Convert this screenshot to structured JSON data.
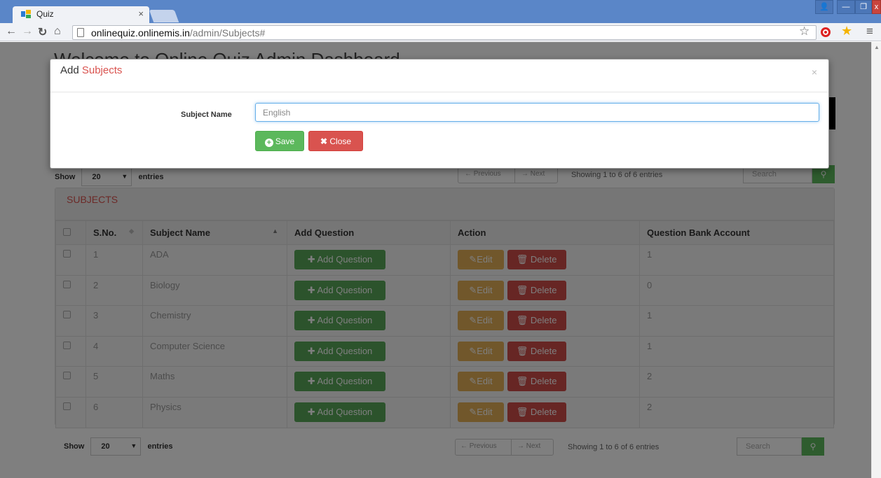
{
  "browser": {
    "tab_title": "Quiz",
    "tab_close": "×",
    "url_host": "onlinequiz.onlinemis.in",
    "url_path": "/admin/Subjects#",
    "window_user_icon": "👤",
    "window_min": "—",
    "window_max": "❐",
    "window_close": "x"
  },
  "page": {
    "heading": "Welcome to Online Quiz Admin Dashboard",
    "show_label": "Show",
    "entries_label": "entries",
    "page_length": "20",
    "prev_label": "← Previous",
    "next_label": "→ Next",
    "info_text": "Showing 1 to 6 of 6 entries",
    "search_placeholder": "Search",
    "panel_title": "SUBJECTS"
  },
  "table": {
    "columns": [
      "S.No.",
      "Subject Name",
      "Add Question",
      "Action",
      "Question Bank Account"
    ],
    "add_question_label": "Add Question",
    "edit_label": "Edit",
    "delete_label": "Delete",
    "rows": [
      {
        "sno": "1",
        "subject": "ADA",
        "bank": "1"
      },
      {
        "sno": "2",
        "subject": "Biology",
        "bank": "0"
      },
      {
        "sno": "3",
        "subject": "Chemistry",
        "bank": "1"
      },
      {
        "sno": "4",
        "subject": "Computer Science",
        "bank": "1"
      },
      {
        "sno": "5",
        "subject": "Maths",
        "bank": "2"
      },
      {
        "sno": "6",
        "subject": "Physics",
        "bank": "2"
      }
    ]
  },
  "modal": {
    "title_prefix": "Add ",
    "title_accent": "Subjects",
    "close_x": "×",
    "field_label": "Subject Name",
    "field_value": "English",
    "save_label": "Save",
    "close_label": "Close"
  },
  "colors": {
    "accent": "#d9534f",
    "success": "#5cb85c",
    "warning": "#f0ad4e",
    "danger": "#d9534f"
  }
}
